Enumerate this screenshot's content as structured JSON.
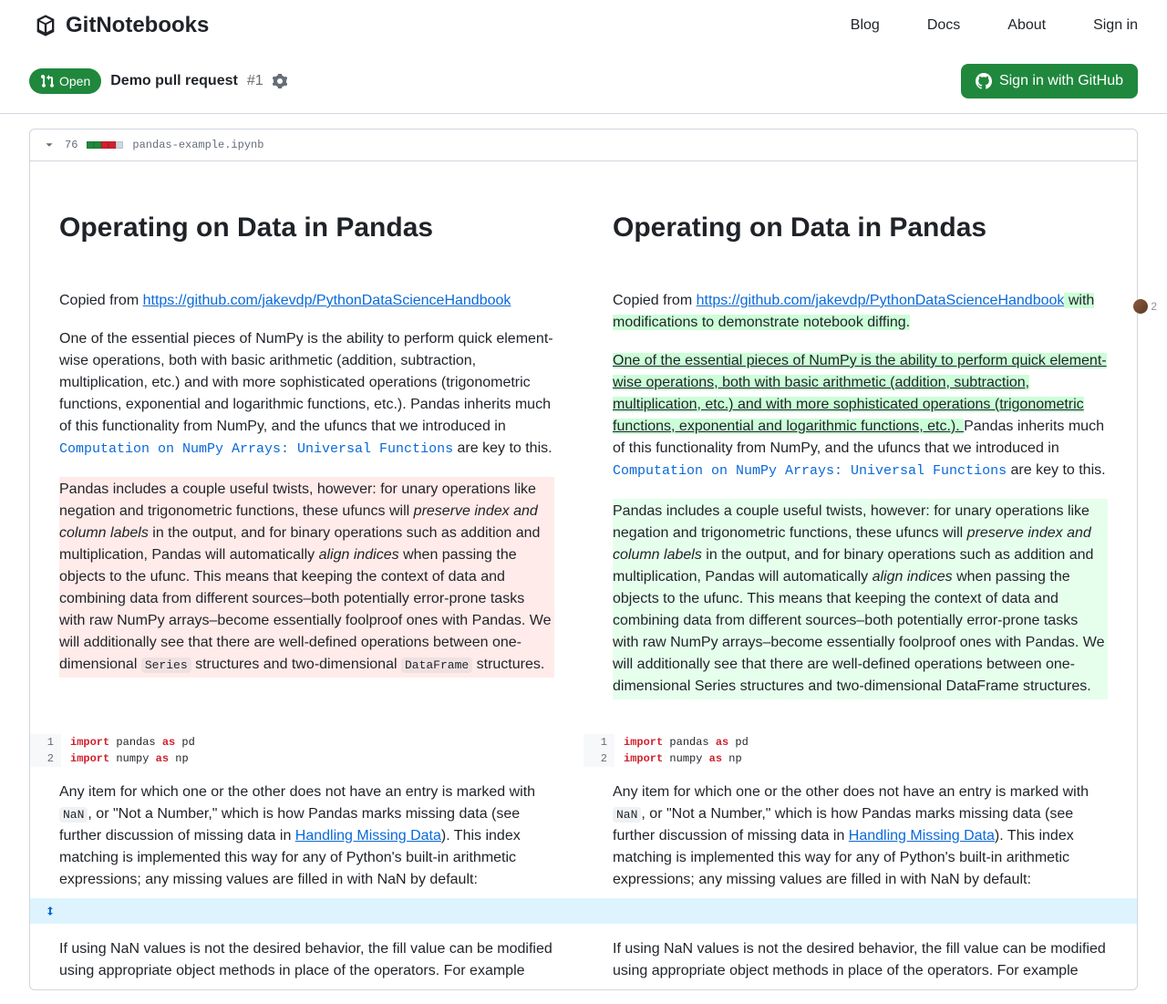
{
  "brand": "GitNotebooks",
  "nav": {
    "blog": "Blog",
    "docs": "Docs",
    "about": "About",
    "signin": "Sign in"
  },
  "pr": {
    "open": "Open",
    "title": "Demo pull request",
    "num": "#1",
    "signin_gh": "Sign in with GitHub"
  },
  "file": {
    "count": "76",
    "name": "pandas-example.ipynb"
  },
  "h1": "Operating on Data in Pandas",
  "copied": "Copied from ",
  "url": "https://github.com/jakevdp/PythonDataScienceHandbook",
  "mod_suffix": " with modifications to demonstrate notebook diffing.",
  "p1a": "One of the essential pieces of NumPy is the ability to perform quick element-wise operations, both with basic arithmetic (addition, subtraction, multiplication, etc.) and with more sophisticated operations (trigonometric functions, exponential and logarithmic functions, etc.). ",
  "p1b": "Pandas inherits much of this functionality from NumPy, and the ufuncs that we introduced in ",
  "p1link": "Computation on NumPy Arrays: Universal Functions",
  "p1c": " are key to this.",
  "p2a": "Pandas includes a couple useful twists, however: for unary operations like negation and trigonometric functions, these ufuncs will ",
  "p2i1": "preserve index and column labels",
  "p2b": " in the output, and for binary operations such as addition and multiplication, Pandas will automatically ",
  "p2i2": "align indices",
  "p2c": " when passing the objects to the ufunc. This means that keeping the context of data and combining data from different sources–both potentially error-prone tasks with raw NumPy arrays–become essentially foolproof ones with Pandas. We will additionally see that there are well-defined operations between one-dimensional ",
  "p2series": "Series",
  "p2d": " structures and two-dimensional ",
  "p2df": "DataFrame",
  "p2e": " structures.",
  "p2c_r": " when passing the objects to the ufunc. This means that keeping the context of data and combining data from different sources–both potentially error-prone tasks with raw NumPy arrays–become essentially foolproof ones with Pandas. We will additionally see that there are well-defined operations between one-dimensional Series structures and two-dimensional DataFrame structures.",
  "code": {
    "l1_kw1": "import",
    "l1_t1": " pandas ",
    "l1_kw2": "as",
    "l1_t2": " pd",
    "l2_kw1": "import",
    "l2_t1": " numpy ",
    "l2_kw2": "as",
    "l2_t2": " np",
    "n1": "1",
    "n2": "2"
  },
  "p3a": "Any item for which one or the other does not have an entry is marked with ",
  "p3nan": "NaN",
  "p3b": ", or \"Not a Number,\" which is how Pandas marks missing data (see further discussion of missing data in ",
  "p3link": "Handling Missing Data",
  "p3c": "). This index matching is implemented this way for any of Python's built-in arithmetic expressions; any missing values are filled in with NaN by default:",
  "p4": "If using NaN values is not the desired behavior, the fill value can be modified using appropriate object methods in place of the operators. For example",
  "avatar_n": "2"
}
